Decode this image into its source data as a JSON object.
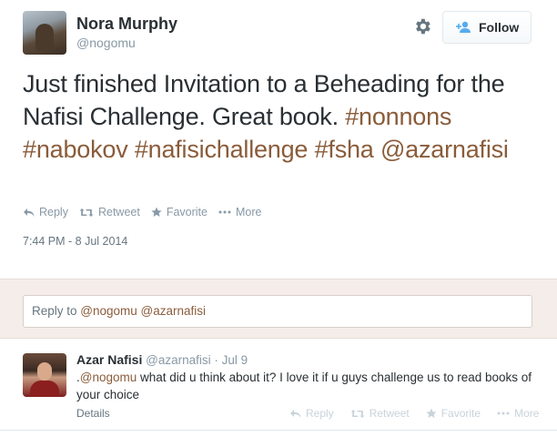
{
  "tweet": {
    "author_name": "Nora Murphy",
    "author_handle": "@nogomu",
    "follow_label": "Follow",
    "text_plain_1": "Just finished Invitation to a Beheading for the Nafisi Challenge. Great book. ",
    "tag_nonnons": "#nonnons",
    "tag_nabokov": "#nabokov",
    "tag_nafisichallenge": "#nafisichallenge",
    "tag_fsha": "#fsha",
    "mention_azarnafisi": "@azarnafisi",
    "actions": {
      "reply": "Reply",
      "retweet": "Retweet",
      "favorite": "Favorite",
      "more": "More"
    },
    "timestamp": "7:44 PM - 8 Jul 2014"
  },
  "reply_composer": {
    "prefix": "Reply to ",
    "mentions": "@nogomu @azarnafisi"
  },
  "reply_tweet": {
    "author_name": "Azar Nafisi",
    "author_handle": "@azarnafisi",
    "date": " · Jul 9",
    "text_prefix": ".",
    "mention": "@nogomu",
    "text": " what did u think about it? I love it if u guys challenge us to read books of your choice",
    "details_label": "Details",
    "actions": {
      "reply": "Reply",
      "retweet": "Retweet",
      "favorite": "Favorite",
      "more": "More"
    }
  },
  "colors": {
    "hashtag": "#8a5c3a",
    "reply_panel_bg": "#f5ede9",
    "muted": "#8899a6"
  },
  "icons": [
    "user-avatar-icon",
    "gear-icon",
    "add-user-icon",
    "reply-icon",
    "retweet-icon",
    "star-icon",
    "ellipsis-icon"
  ]
}
